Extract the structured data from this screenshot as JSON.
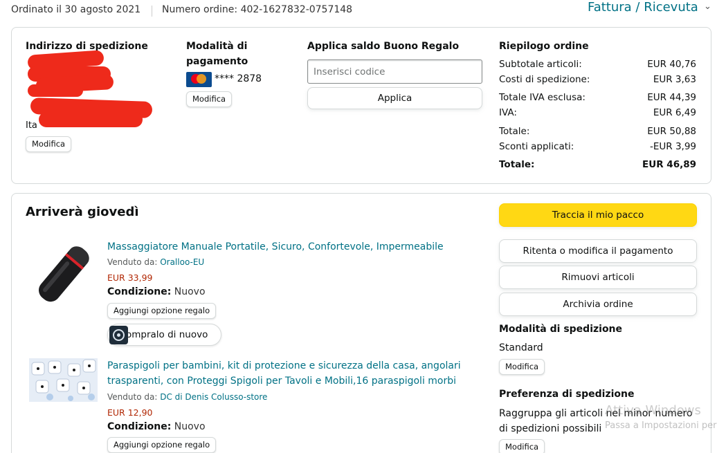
{
  "header": {
    "order_date": "Ordinato il 30 agosto 2021",
    "order_number": "Numero ordine: 402-1627832-0757148",
    "invoice_link": "Fattura / Ricevuta",
    "invoice_chevron": "⌄"
  },
  "shipping_address": {
    "title": "Indirizzo di spedizione",
    "visible_line": "Ita",
    "edit_label": "Modifica"
  },
  "payment": {
    "title": "Modalità di pagamento",
    "card_digits": "**** 2878",
    "edit_label": "Modifica"
  },
  "gift_card": {
    "title": "Applica saldo Buono Regalo",
    "placeholder": "Inserisci codice",
    "apply_label": "Applica"
  },
  "summary": {
    "title": "Riepilogo ordine",
    "rows": [
      {
        "label": "Subtotale articoli:",
        "value": "EUR 40,76"
      },
      {
        "label": "Costi di spedizione:",
        "value": "EUR 3,63"
      },
      {
        "label": "Totale IVA esclusa:",
        "value": "EUR 44,39"
      },
      {
        "label": "IVA:",
        "value": "EUR 6,49"
      },
      {
        "label": "Totale:",
        "value": "EUR 50,88"
      },
      {
        "label": "Sconti applicati:",
        "value": "-EUR 3,99"
      },
      {
        "label": "Totale:",
        "value": "EUR 46,89"
      }
    ]
  },
  "shipment": {
    "heading": "Arriverà giovedì",
    "items": [
      {
        "title": "Massaggiatore Manuale Portatile, Sicuro, Confortevole, Impermeabile",
        "sold_by_label": "Venduto da:",
        "seller": "Oralloo-EU",
        "price": "EUR 33,99",
        "condition_label": "Condizione:",
        "condition": "Nuovo",
        "gift_option": "Aggiungi opzione regalo",
        "buy_again": "ompralo di nuovo"
      },
      {
        "title_line1": "Paraspigoli per bambini, kit di protezione e sicurezza della casa, angolari",
        "title_line2": "trasparenti, con Proteggi Spigoli per Tavoli e Mobili,16 paraspigoli morbi",
        "sold_by_label": "Venduto da:",
        "seller": "DC di Denis Colusso-store",
        "price": "EUR 12,90",
        "condition_label": "Condizione:",
        "condition": "Nuovo",
        "gift_option": "Aggiungi opzione regalo"
      }
    ],
    "actions": {
      "track": "Traccia il mio pacco",
      "retry_payment": "Ritenta o modifica il pagamento",
      "remove_items": "Rimuovi articoli",
      "archive": "Archivia ordine"
    },
    "shipping_method": {
      "title": "Modalità di spedizione",
      "value": "Standard",
      "edit_label": "Modifica"
    },
    "shipping_preference": {
      "title": "Preferenza di spedizione",
      "line1": "Raggruppa gli articoli nel minor numero",
      "line2": "di spedizioni possibili",
      "edit_label": "Modifica"
    }
  },
  "watermark": {
    "line1": "Attiva Windows",
    "line2": "Passa a Impostazioni per"
  },
  "colors": {
    "link": "#007185",
    "price": "#B12704",
    "primary_button": "#FFD814",
    "redaction": "#EE2A1B"
  }
}
